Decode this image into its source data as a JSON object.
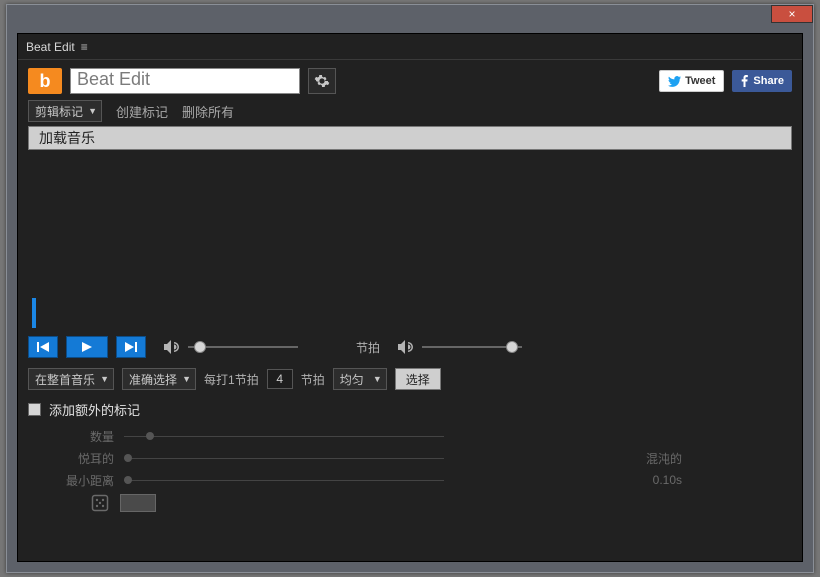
{
  "window": {
    "title": "Beat Edit",
    "menu_glyph": "≡"
  },
  "win_btns": {
    "close_glyph": "×"
  },
  "header": {
    "logo_letter": "b",
    "title_text": "Beat Edit",
    "tweet_label": "Tweet",
    "share_label": "Share"
  },
  "row2": {
    "marker_type_label": "剪辑标记",
    "create_markers_label": "创建标记",
    "delete_all_label": "删除所有"
  },
  "row3": {
    "load_music_label": "加载音乐"
  },
  "play": {
    "beat_label": "节拍"
  },
  "sel": {
    "scope_label": "在整首音乐",
    "precision_label": "准确选择",
    "every_beat_prefix": "每打1节拍",
    "every_value": "4",
    "every_beat_suffix": "节拍",
    "even_label": "均匀",
    "choose_label": "选择"
  },
  "extra": {
    "title": "添加额外的标记",
    "qty_label": "数量",
    "pleasant_label": "悦耳的",
    "chaotic_label": "混沌的",
    "min_dist_label": "最小距离",
    "min_dist_value": "0.10s"
  }
}
